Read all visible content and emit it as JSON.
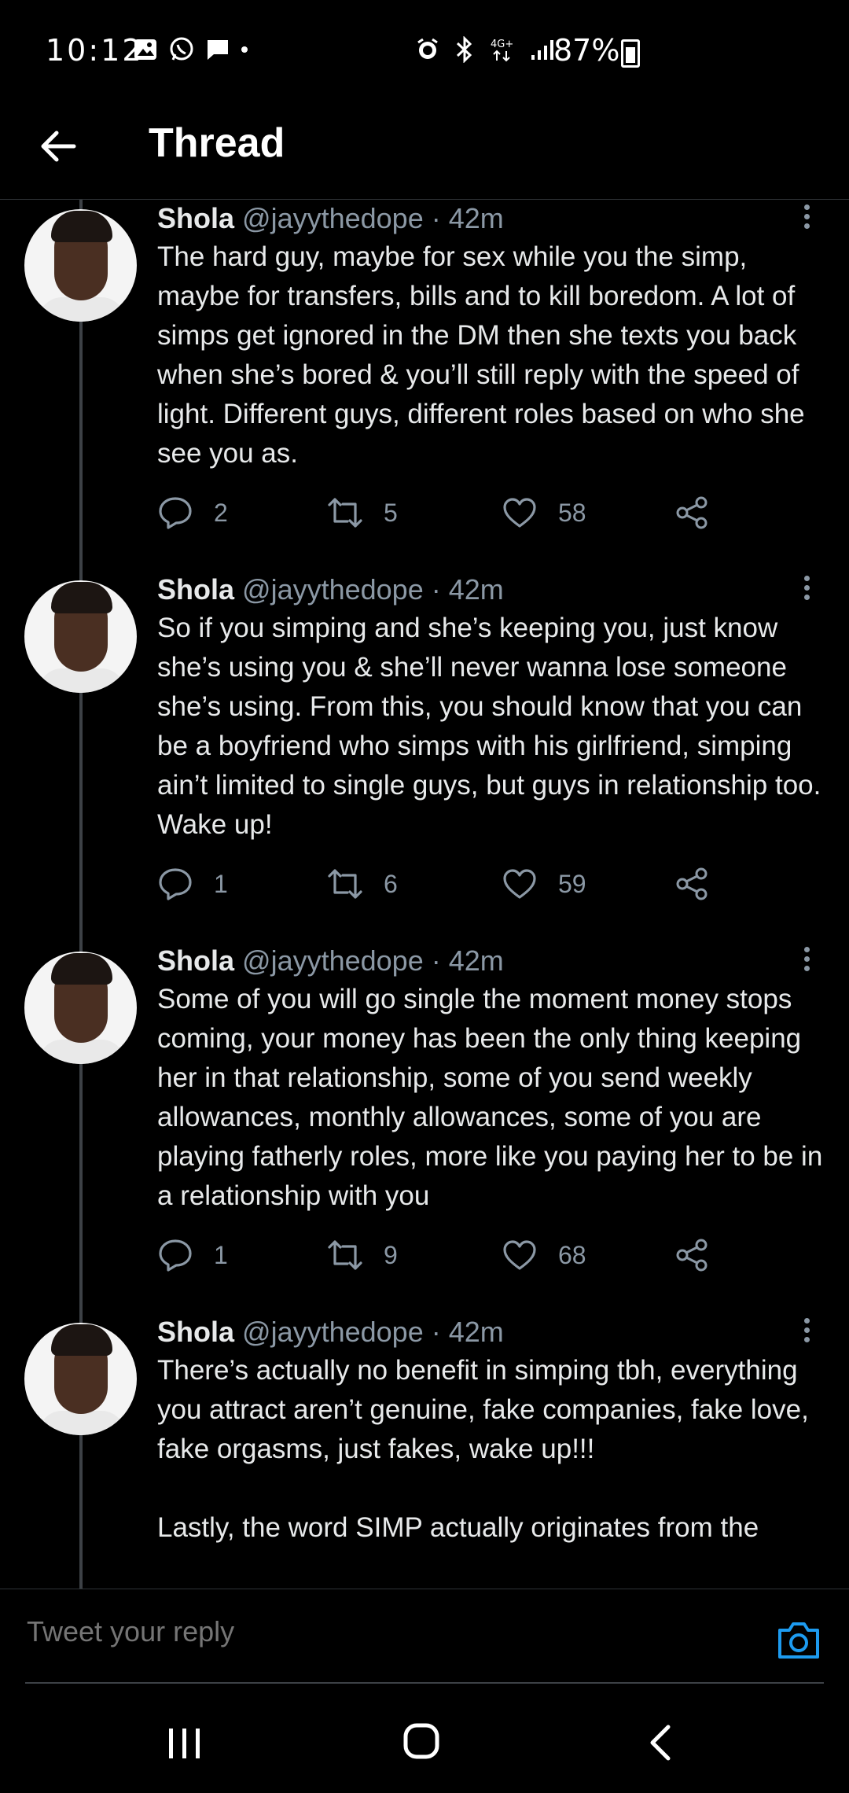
{
  "status_bar": {
    "time": "10:12",
    "battery": "87%",
    "left_icons": [
      "gallery-icon",
      "whatsapp-icon",
      "message-icon",
      "dot-icon"
    ],
    "right_icons": [
      "alarm-icon",
      "bluetooth-icon",
      "4g-icon",
      "signal-icon",
      "battery-icon"
    ]
  },
  "header": {
    "title": "Thread",
    "back_icon": "arrow-left-icon"
  },
  "tweets": [
    {
      "name": "Shola",
      "handle": "@jayythedope",
      "dot": "·",
      "time": "42m",
      "text": "The hard guy, maybe for sex while you the simp, maybe for transfers, bills and to kill boredom. A lot of simps get ignored in the DM then she texts you back when she’s bored & you’ll still reply with the speed of light. Different guys, different roles based on who she see you as.",
      "replies": "2",
      "retweets": "5",
      "likes": "58"
    },
    {
      "name": "Shola",
      "handle": "@jayythedope",
      "dot": "·",
      "time": "42m",
      "text": "So if you simping and she’s keeping you, just know she’s using you & she’ll never wanna lose someone she’s using. From this, you should know that you can be a boyfriend who simps with his girlfriend, simping ain’t limited to single guys, but guys in relationship too. Wake up!",
      "replies": "1",
      "retweets": "6",
      "likes": "59"
    },
    {
      "name": "Shola",
      "handle": "@jayythedope",
      "dot": "·",
      "time": "42m",
      "text": "Some of you will go single the moment money stops coming, your money has been the only thing keeping her in that relationship, some of you send weekly allowances, monthly allowances, some of you are playing fatherly roles, more like you paying her to be in a relationship with you",
      "replies": "1",
      "retweets": "9",
      "likes": "68"
    },
    {
      "name": "Shola",
      "handle": "@jayythedope",
      "dot": "·",
      "time": "42m",
      "text": "There’s actually no benefit in simping tbh, everything you attract aren’t genuine, fake companies, fake love, fake orgasms, just fakes, wake up!!!\n\nLastly, the word SIMP actually originates from the"
    }
  ],
  "reply_bar": {
    "placeholder": "Tweet your reply",
    "camera_icon": "camera-icon"
  },
  "colors": {
    "background": "#000000",
    "secondary_text": "#8b98a5",
    "accent": "#1d9bf0",
    "divider": "#2f3336"
  }
}
